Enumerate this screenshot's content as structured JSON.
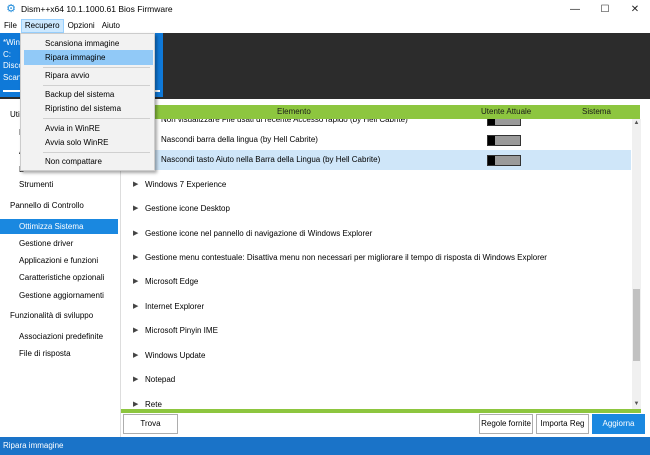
{
  "window": {
    "title": "Dism++x64 10.1.1000.61 Bios Firmware",
    "icon": "gear-icon",
    "minimize": "—",
    "maximize": "☐",
    "close": "✕"
  },
  "menubar": [
    "File",
    "Recupero",
    "Opzioni",
    "Aiuto"
  ],
  "drive_tile": [
    "*Win",
    "C:",
    "Disco",
    "Scans"
  ],
  "recupero_menu": {
    "items": [
      "Scansiona immagine",
      "Ripara immagine",
      "Ripara avvio",
      "Backup del sistema",
      "Ripristino del sistema",
      "Avvia in WinRE",
      "Avvia solo WinRE",
      "Non compattare"
    ],
    "highlighted": "Ripara immagine"
  },
  "sidebar": {
    "partial_items": [
      "Uti",
      "F",
      "A",
      "D"
    ],
    "items": [
      "Strumenti",
      "Pannello di Controllo",
      "Ottimizza Sistema",
      "Gestione driver",
      "Applicazioni e funzioni",
      "Caratteristiche opzionali",
      "Gestione aggiornamenti",
      "Funzionalità di sviluppo",
      "Associazioni predefinite",
      "File di risposta"
    ],
    "selected": "Ottimizza Sistema"
  },
  "grid": {
    "headers": {
      "elemento": "Elemento",
      "utente": "Utente Attuale",
      "sistema": "Sistema"
    },
    "rows": [
      {
        "label": "Non visualizzare File usati di recente Accesso rapido (by Hell Cabrite)",
        "toggle": "off"
      },
      {
        "label": "Nascondi barra della lingua (by Hell Cabrite)",
        "toggle": "off"
      },
      {
        "label": "Nascondi tasto Aiuto nella Barra della Lingua (by Hell Cabrite)",
        "toggle": "off"
      }
    ],
    "groups": [
      "Windows 7 Experience",
      "Gestione icone Desktop",
      "Gestione icone nel pannello di navigazione di Windows Explorer",
      "Gestione menu contestuale: Disattiva menu non necessari per migliorare il tempo di risposta di Windows Explorer",
      "Microsoft Edge",
      "Internet Explorer",
      "Microsoft Pinyin IME",
      "Windows Update",
      "Notepad",
      "Rete"
    ],
    "group_arrow": "▶"
  },
  "buttons": {
    "find": "Trova",
    "rules": "Regole fornite",
    "import": "Importa Reg",
    "refresh": "Aggiorna"
  },
  "status": "Ripara immagine",
  "colors": {
    "accent": "#1a88e0",
    "header_green": "#8dc63f",
    "status_blue": "#1a73c8"
  }
}
